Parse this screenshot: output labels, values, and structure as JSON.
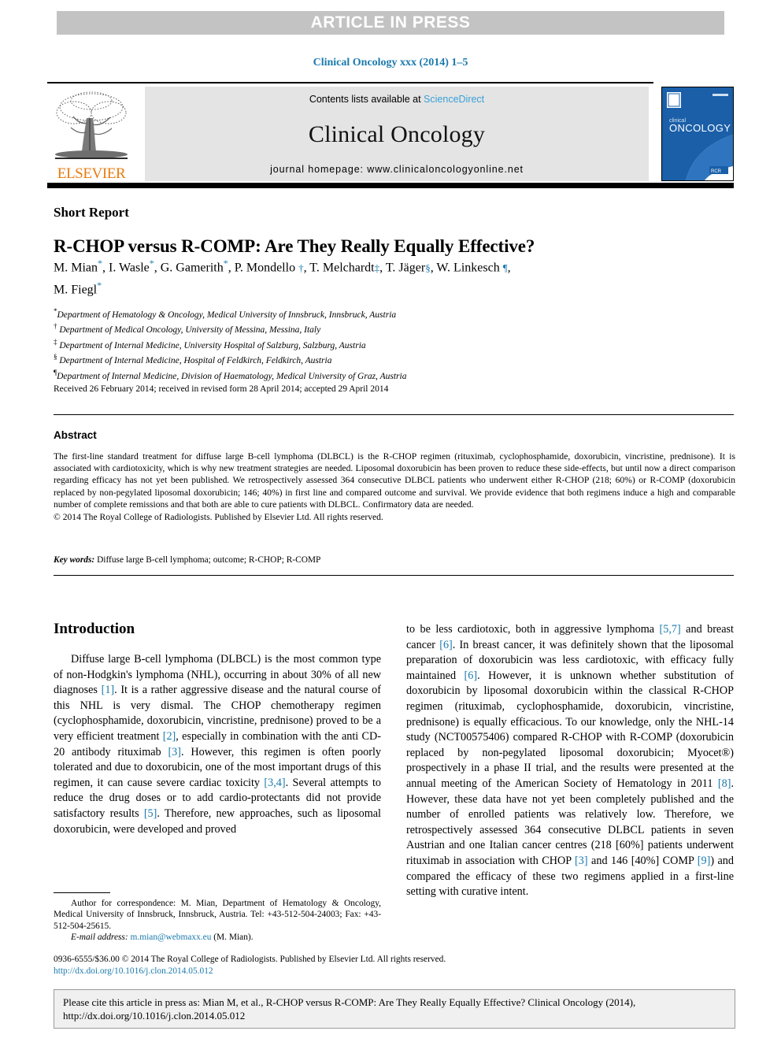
{
  "banner": {
    "text": "ARTICLE IN PRESS"
  },
  "running_citation": "Clinical Oncology xxx (2014) 1–5",
  "masthead": {
    "publisher_wordmark": "ELSEVIER",
    "contents_prefix": "Contents lists available at ",
    "contents_link": "ScienceDirect",
    "journal_name": "Clinical Oncology",
    "homepage": "journal homepage: www.clinicaloncologyonline.net",
    "cover": {
      "brand_small": "clinical",
      "brand_large": "ONCOLOGY",
      "footer_badge": "RCR",
      "accent_color": "#1a5fa8"
    }
  },
  "article": {
    "type_label": "Short Report",
    "title": "R-CHOP versus R-COMP: Are They Really Equally Effective?",
    "authors_line1": "M. Mian",
    "authors": [
      {
        "name": "M. Mian",
        "marker": "*"
      },
      {
        "name": "I. Wasle",
        "marker": "*"
      },
      {
        "name": "G. Gamerith",
        "marker": "*"
      },
      {
        "name": "P. Mondello",
        "marker": "†"
      },
      {
        "name": "T. Melchardt",
        "marker": "‡"
      },
      {
        "name": "T. Jäger",
        "marker": "§"
      },
      {
        "name": "W. Linkesch",
        "marker": "¶"
      },
      {
        "name": "M. Fiegl",
        "marker": "*"
      }
    ],
    "affiliations": [
      {
        "sym": "*",
        "text": "Department of Hematology & Oncology, Medical University of Innsbruck, Innsbruck, Austria"
      },
      {
        "sym": "†",
        "text": "Department of Medical Oncology, University of Messina, Messina, Italy"
      },
      {
        "sym": "‡",
        "text": "Department of Internal Medicine, University Hospital of Salzburg, Salzburg, Austria"
      },
      {
        "sym": "§",
        "text": "Department of Internal Medicine, Hospital of Feldkirch, Feldkirch, Austria"
      },
      {
        "sym": "¶",
        "text": "Department of Internal Medicine, Division of Haematology, Medical University of Graz, Austria"
      }
    ],
    "history": "Received 26 February 2014; received in revised form 28 April 2014; accepted 29 April 2014"
  },
  "abstract": {
    "heading": "Abstract",
    "body": "The first-line standard treatment for diffuse large B-cell lymphoma (DLBCL) is the R-CHOP regimen (rituximab, cyclophosphamide, doxorubicin, vincristine, prednisone). It is associated with cardiotoxicity, which is why new treatment strategies are needed. Liposomal doxorubicin has been proven to reduce these side-effects, but until now a direct comparison regarding efficacy has not yet been published. We retrospectively assessed 364 consecutive DLBCL patients who underwent either R-CHOP (218; 60%) or R-COMP (doxorubicin replaced by non-pegylated liposomal doxorubicin; 146; 40%) in first line and compared outcome and survival. We provide evidence that both regimens induce a high and comparable number of complete remissions and that both are able to cure patients with DLBCL. Confirmatory data are needed.",
    "copyright": "© 2014 The Royal College of Radiologists. Published by Elsevier Ltd. All rights reserved.",
    "keywords_label": "Key words:",
    "keywords_value": " Diffuse large B-cell lymphoma; outcome; R-CHOP; R-COMP"
  },
  "introduction": {
    "heading": "Introduction",
    "left_paragraph_parts": [
      "Diffuse large B-cell lymphoma (DLBCL) is the most common type of non-Hodgkin's lymphoma (NHL), occurring in about 30% of all new diagnoses ",
      "[1]",
      ". It is a rather aggressive disease and the natural course of this NHL is very dismal. The CHOP chemotherapy regimen (cyclophosphamide, doxorubicin, vincristine, prednisone) proved to be a very efficient treatment ",
      "[2]",
      ", especially in combination with the anti CD-20 antibody rituximab ",
      "[3]",
      ". However, this regimen is often poorly tolerated and due to doxorubicin, one of the most important drugs of this regimen, it can cause severe cardiac toxicity ",
      "[3,4]",
      ". Several attempts to reduce the drug doses or to add cardio-protectants did not provide satisfactory results ",
      "[5]",
      ". Therefore, new approaches, such as liposomal doxorubicin, were developed and proved"
    ],
    "right_paragraph_parts": [
      "to be less cardiotoxic, both in aggressive lymphoma ",
      "[5,7]",
      " and breast cancer ",
      "[6]",
      ". In breast cancer, it was definitely shown that the liposomal preparation of doxorubicin was less cardiotoxic, with efficacy fully maintained ",
      "[6]",
      ". However, it is unknown whether substitution of doxorubicin by liposomal doxorubicin within the classical R-CHOP regimen (rituximab, cyclophosphamide, doxorubicin, vincristine, prednisone) is equally efficacious. To our knowledge, only the NHL-14 study (NCT00575406) compared R-CHOP with R-COMP (doxorubicin replaced by non-pegylated liposomal doxorubicin; Myocet®) prospectively in a phase II trial, and the results were presented at the annual meeting of the American Society of Hematology in 2011 ",
      "[8]",
      ". However, these data have not yet been completely published and the number of enrolled patients was relatively low. Therefore, we retrospectively assessed 364 consecutive DLBCL patients in seven Austrian and one Italian cancer centres (218 [60%] patients underwent rituximab in association with CHOP ",
      "[3]",
      " and 146 [40%] COMP ",
      "[9]",
      ") and compared the efficacy of these two regimens applied in a first-line setting with curative intent."
    ]
  },
  "footnote": {
    "correspondence": "Author for correspondence: M. Mian, Department of Hematology & Oncology, Medical University of Innsbruck, Innsbruck, Austria. Tel: +43-512-504-24003; Fax: +43-512-504-25615.",
    "email_label": "E-mail address:",
    "email": "m.mian@webmaxx.eu",
    "email_suffix": " (M. Mian)."
  },
  "bottom": {
    "issn_copyright": "0936-6555/$36.00 © 2014 The Royal College of Radiologists. Published by Elsevier Ltd. All rights reserved.",
    "doi": "http://dx.doi.org/10.1016/j.clon.2014.05.012",
    "cite_notice": "Please cite this article in press as: Mian M, et al., R-CHOP versus R-COMP: Are They Really Equally Effective? Clinical Oncology (2014), http://dx.doi.org/10.1016/j.clon.2014.05.012"
  }
}
